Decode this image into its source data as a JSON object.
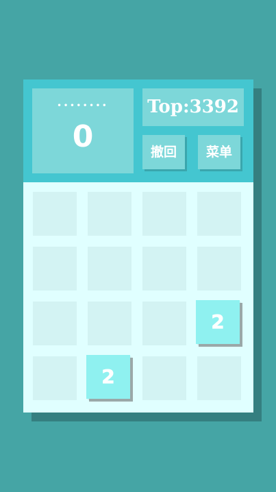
{
  "score": {
    "dots": "••••••••",
    "value": "0"
  },
  "top": {
    "label": "Top:3392"
  },
  "buttons": {
    "undo": "撤回",
    "menu": "菜单"
  },
  "board": {
    "size": 4,
    "tiles": [
      {
        "row": 2,
        "col": 3,
        "value": "2"
      },
      {
        "row": 3,
        "col": 1,
        "value": "2"
      }
    ]
  },
  "colors": {
    "background": "#45a5a5",
    "header": "#44c6d0",
    "panel": "#7dd7d9",
    "board": "#e0ffff",
    "empty_cell": "#d3f3f3",
    "tile_2": "#8ff1f0"
  }
}
